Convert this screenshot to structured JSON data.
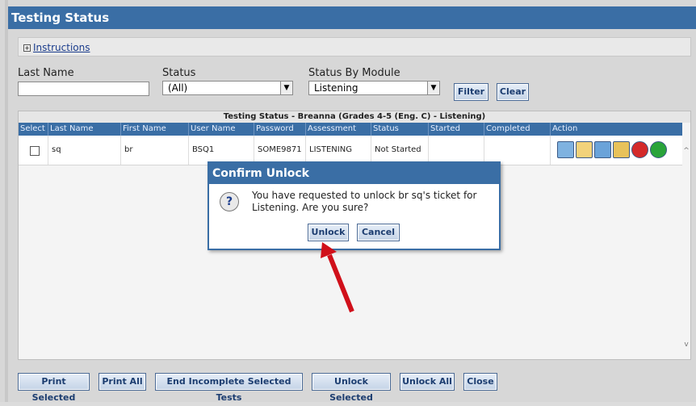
{
  "window": {
    "title": "Testing Status"
  },
  "instructions": {
    "label": "Instructions"
  },
  "filters": {
    "last_name_label": "Last Name",
    "last_name_value": "",
    "status_label": "Status",
    "status_value": "(All)",
    "module_label": "Status By Module",
    "module_value": "Listening",
    "filter_button": "Filter",
    "clear_button": "Clear"
  },
  "grid": {
    "caption": "Testing Status - Breanna (Grades 4-5 (Eng. C) - Listening)",
    "columns": [
      "Select",
      "Last Name",
      "First Name",
      "User Name",
      "Password",
      "Assessment",
      "Status",
      "Started",
      "Completed",
      "Action"
    ],
    "rows": [
      {
        "last_name": "sq",
        "first_name": "br",
        "user_name": "BSQ1",
        "password": "SOME9871",
        "assessment": "LISTENING",
        "status": "Not Started",
        "started": "",
        "completed": ""
      }
    ],
    "action_icons": [
      "print-ticket-icon",
      "key-icon",
      "user-icon",
      "lock-icon",
      "stop-icon",
      "go-icon"
    ]
  },
  "dialog": {
    "title": "Confirm Unlock",
    "message": "You have requested to unlock br sq's ticket for Listening. Are you sure?",
    "unlock_button": "Unlock",
    "cancel_button": "Cancel",
    "icon": "question-icon"
  },
  "footer": {
    "print_selected": "Print Selected",
    "print_all": "Print All",
    "end_incomplete": "End Incomplete Selected Tests",
    "unlock_selected": "Unlock Selected",
    "unlock_all": "Unlock All",
    "close": "Close"
  },
  "colors": {
    "accent": "#3a6ea5",
    "annotation_arrow": "#d0101a"
  }
}
